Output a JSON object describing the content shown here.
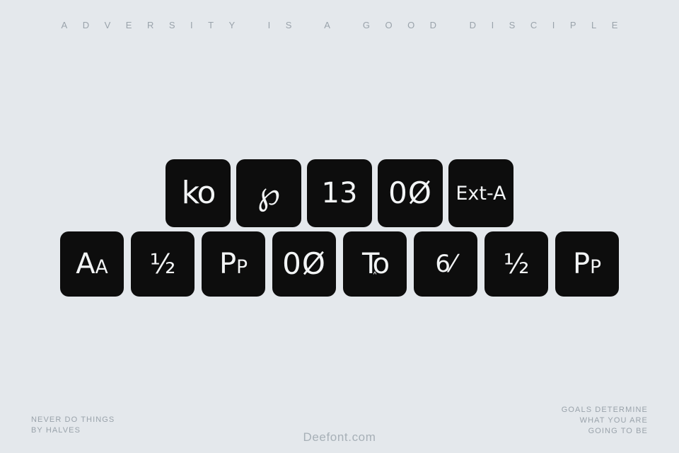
{
  "page": {
    "background_color": "#e4e8ec",
    "tile_color": "#0d0d0d",
    "tile_text_color": "#f2f4f5",
    "caption_color": "#9aa3ab"
  },
  "headline": {
    "text": "ADVERSITY IS A GOOD DISCIPLE"
  },
  "tiles": {
    "row_1": [
      {
        "glyph": "ko",
        "feature": "ligature-ko",
        "style": "g-lig"
      },
      {
        "glyph": "℘",
        "feature": "swash-ornament",
        "style": "g-swash"
      },
      {
        "glyph": "13",
        "feature": "oldstyle-figures",
        "style": "g-num"
      },
      {
        "glyph": "0Ø",
        "feature": "slashed-zero",
        "style": "g-zero"
      },
      {
        "glyph": "Ext-A",
        "feature": "latin-extended-a",
        "style": "g-tag"
      }
    ],
    "row_2": [
      {
        "glyph": "Aa",
        "feature": "small-caps-a",
        "style": "g-case"
      },
      {
        "glyph": "½",
        "feature": "fraction-half",
        "style": "g-frac"
      },
      {
        "glyph": "Pp",
        "feature": "small-caps-p",
        "style": "g-case"
      },
      {
        "glyph": "0Ø",
        "feature": "slashed-zero",
        "style": "g-zero"
      },
      {
        "glyph": "To",
        "feature": "kerning-pair",
        "style": "g-kern",
        "caret": "˄"
      },
      {
        "glyph": "6⁄",
        "feature": "fraction-slash",
        "style": "g-fracslash"
      },
      {
        "glyph": "½",
        "feature": "fraction-half",
        "style": "g-frac"
      },
      {
        "glyph": "Pp",
        "feature": "small-caps-p",
        "style": "g-case"
      }
    ]
  },
  "footer": {
    "caption_left": "NEVER DO THINGS\nBY HALVES",
    "caption_right": "GOALS DETERMINE\nWHAT YOU ARE\nGOING TO BE",
    "wordmark": "Deefont.com"
  }
}
